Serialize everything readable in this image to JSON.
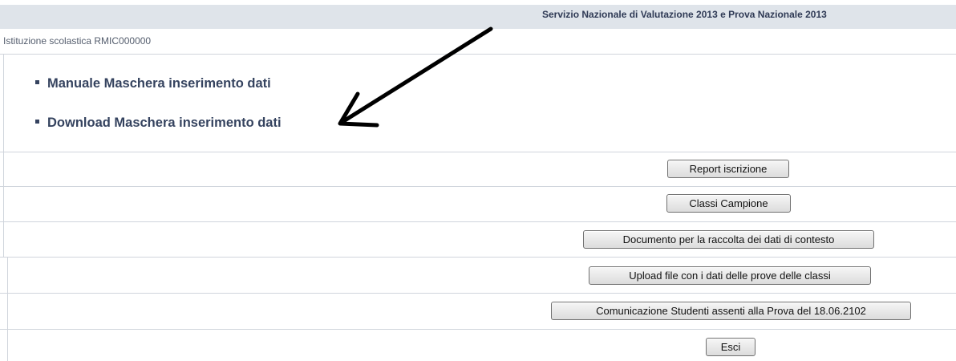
{
  "header": {
    "title": "Servizio Nazionale di Valutazione 2013 e Prova Nazionale 2013"
  },
  "institution": {
    "label": "Istituzione scolastica RMIC000000"
  },
  "links": {
    "manual": "Manuale Maschera inserimento dati",
    "download": "Download Maschera inserimento dati"
  },
  "buttons": {
    "report": "Report iscrizione",
    "classes": "Classi Campione",
    "document": "Documento per la raccolta dei dati di contesto",
    "upload": "Upload file con i dati delle prove delle classi",
    "absent": "Comunicazione Studenti assenti alla Prova del 18.06.2102",
    "exit": "Esci"
  },
  "annotation": {
    "arrow_color": "#000000",
    "arrow_icon": "arrow-pointer-icon"
  }
}
